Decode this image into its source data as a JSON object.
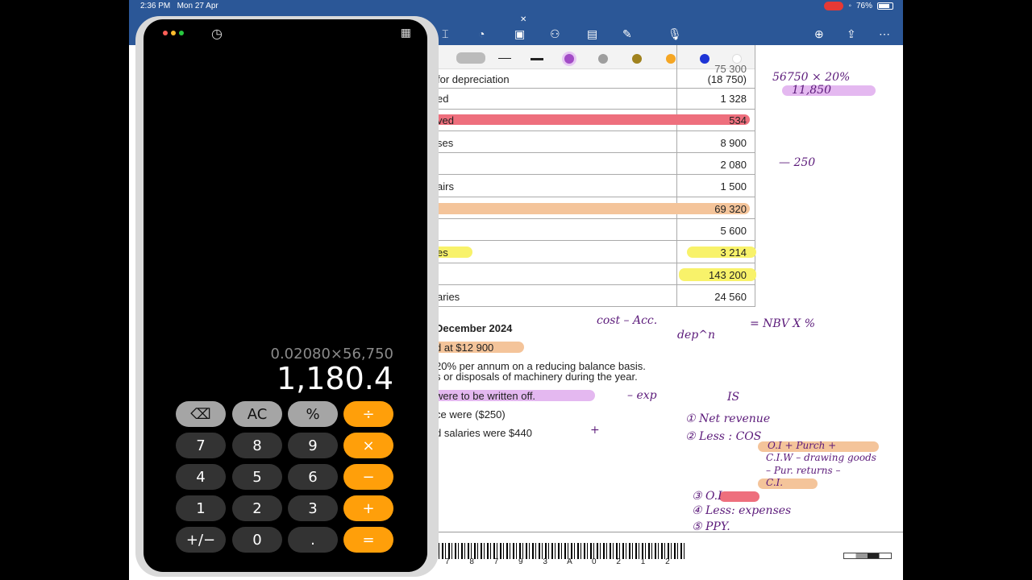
{
  "status": {
    "time": "2:36 PM",
    "date": "Mon 27 Apr",
    "battery": "76%"
  },
  "pen_colors": [
    "#a24cc6",
    "#9e9e9e",
    "#a0821e",
    "#f5a623",
    "#1e35d6",
    "#ffffff"
  ],
  "table": {
    "rows": [
      {
        "label": "for depreciation",
        "value": "(18 750)"
      },
      {
        "label": "ed",
        "value": "1 328"
      },
      {
        "label": "ved",
        "value": "534"
      },
      {
        "label": "ses",
        "value": "8 900"
      },
      {
        "label": "",
        "value": "2 080"
      },
      {
        "label": "airs",
        "value": "1 500"
      },
      {
        "label": "",
        "value": "69 320"
      },
      {
        "label": "",
        "value": "5 600"
      },
      {
        "label": "es",
        "value": "3 214"
      },
      {
        "label": "",
        "value": "143 200"
      },
      {
        "label": "aries",
        "value": "24 560"
      }
    ],
    "top_value": "75 300"
  },
  "notes": {
    "heading": "December 2024",
    "line1": "d at $12 900",
    "line2": "20% per annum on a reducing balance basis.",
    "line3": "s or disposals of machinery during the year.",
    "line4": "were to be written off.",
    "line5": "ce were ($250)",
    "line6": "d salaries were $440"
  },
  "ink": {
    "calc": "56750 × 20%",
    "calc_result": "11,850",
    "minus250": "— 250",
    "formula1": "cost  – Acc.",
    "formula2": "dep^n",
    "formula3": "= NBV  X  %",
    "exp": "– exp",
    "plus": "+",
    "is": "IS",
    "item1": "① Net revenue",
    "item2": "② Less : COS",
    "item2a": "O.I + Purch +",
    "item2b": "C.I.W – drawing goods",
    "item2c": "– Pur. returns –",
    "item2d": "C.I.",
    "item3": "③ O.I",
    "item4": "④ Less: expenses",
    "item5": "⑤ PPY."
  },
  "barcode": "7 8 7 9 3 A 0 2 1 2",
  "calculator": {
    "expression": "0.02080×56,750",
    "result": "1,180.4",
    "keys": [
      [
        "⌫",
        "AC",
        "%",
        "÷"
      ],
      [
        "7",
        "8",
        "9",
        "×"
      ],
      [
        "4",
        "5",
        "6",
        "−"
      ],
      [
        "1",
        "2",
        "3",
        "+"
      ],
      [
        "+/−",
        "0",
        ".",
        "="
      ]
    ]
  }
}
